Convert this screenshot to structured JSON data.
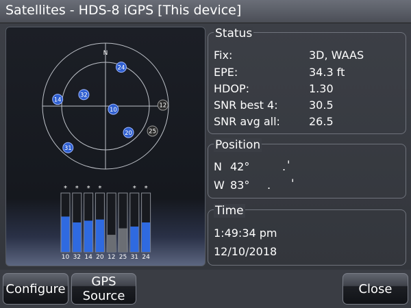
{
  "window": {
    "title": "Satellites - HDS-8 iGPS [This device]"
  },
  "sky": {
    "north_label": "N",
    "satellites": [
      {
        "id": "24",
        "az": 22,
        "el": 30,
        "style": "blue"
      },
      {
        "id": "32",
        "az": 298,
        "el": 55,
        "style": "blue"
      },
      {
        "id": "14",
        "az": 278,
        "el": 21,
        "style": "blue"
      },
      {
        "id": "12",
        "az": 89,
        "el": 8,
        "style": "dark"
      },
      {
        "id": "10",
        "az": 112,
        "el": 78,
        "style": "blue"
      },
      {
        "id": "25",
        "az": 118,
        "el": 14,
        "style": "dark"
      },
      {
        "id": "20",
        "az": 139,
        "el": 40,
        "style": "blue"
      },
      {
        "id": "31",
        "az": 222,
        "el": 10,
        "style": "blue"
      }
    ]
  },
  "signal_bars": [
    {
      "id": "10",
      "level": 0.6,
      "used": true,
      "marker": "*"
    },
    {
      "id": "32",
      "level": 0.5,
      "used": true,
      "marker": "*"
    },
    {
      "id": "14",
      "level": 0.53,
      "used": true,
      "marker": "*"
    },
    {
      "id": "20",
      "level": 0.55,
      "used": true,
      "marker": "*"
    },
    {
      "id": "12",
      "level": 0.29,
      "used": false,
      "marker": ""
    },
    {
      "id": "25",
      "level": 0.4,
      "used": false,
      "marker": ""
    },
    {
      "id": "31",
      "level": 0.43,
      "used": true,
      "marker": "*"
    },
    {
      "id": "24",
      "level": 0.5,
      "used": true,
      "marker": "*"
    }
  ],
  "status": {
    "title": "Status",
    "rows": [
      {
        "label": "Fix:",
        "value": "3D, WAAS"
      },
      {
        "label": "EPE:",
        "value": "34.3 ft"
      },
      {
        "label": "HDOP:",
        "value": "1.30"
      },
      {
        "label": "SNR best 4:",
        "value": "30.5"
      },
      {
        "label": "SNR avg all:",
        "value": "26.5"
      }
    ]
  },
  "position": {
    "title": "Position",
    "lat": {
      "hemisphere": "N",
      "degrees": "42°",
      "dot": ".",
      "minute_mark": "'"
    },
    "lon": {
      "hemisphere": "W",
      "degrees": "83°",
      "dot": ".",
      "minute_mark": "'"
    }
  },
  "time": {
    "title": "Time",
    "clock": "1:49:34 pm",
    "date": "12/10/2018"
  },
  "buttons": {
    "configure": "Configure",
    "gps_source_line1": "GPS",
    "gps_source_line2": "Source",
    "close": "Close"
  },
  "colors": {
    "sat_blue": "#2f5fd0",
    "sat_dark": "#2a2a2a",
    "bar_used": "#2f6ae0",
    "bar_unused": "#6b6e74"
  }
}
